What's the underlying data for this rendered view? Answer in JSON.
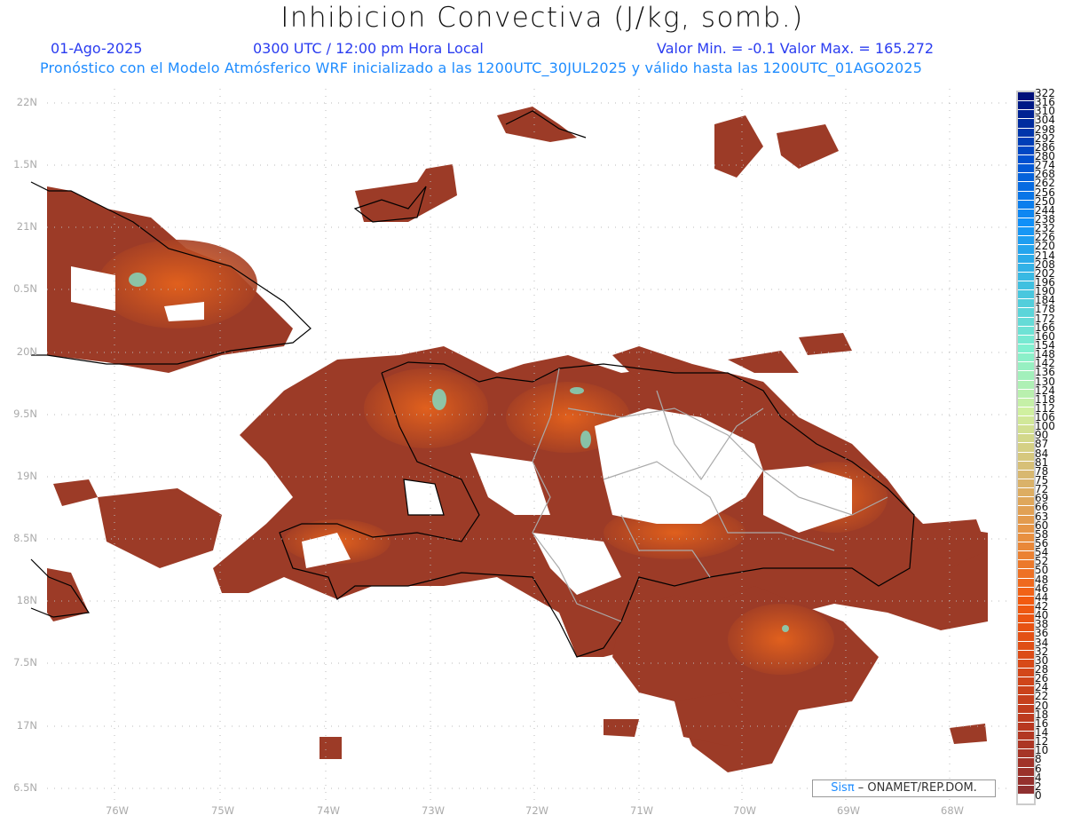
{
  "title": "Inhibicion Convectiva (J/kg, somb.)",
  "date": "01-Ago-2025",
  "time": "0300 UTC / 12:00 pm Hora Local",
  "minmax": "Valor Min. = -0.1  Valor Max. = 165.272",
  "subtitle": "Pronóstico con el Modelo Atmósferico WRF inicializado a las 1200UTC_30JUL2025 y válido hasta las  1200UTC_01AGO2025",
  "lat_labels": [
    "22N",
    "1.5N",
    "21N",
    "0.5N",
    "20N",
    "9.5N",
    "19N",
    "8.5N",
    "18N",
    "7.5N",
    "17N",
    "6.5N"
  ],
  "lon_labels": [
    "76W",
    "75W",
    "74W",
    "73W",
    "72W",
    "71W",
    "70W",
    "69W",
    "68W"
  ],
  "colorbar": {
    "labels": [
      "322",
      "316",
      "310",
      "304",
      "298",
      "292",
      "286",
      "280",
      "274",
      "268",
      "262",
      "256",
      "250",
      "244",
      "238",
      "232",
      "226",
      "220",
      "214",
      "208",
      "202",
      "196",
      "190",
      "184",
      "178",
      "172",
      "166",
      "160",
      "154",
      "148",
      "142",
      "136",
      "130",
      "124",
      "118",
      "112",
      "106",
      "100",
      "90",
      "87",
      "84",
      "81",
      "78",
      "75",
      "72",
      "69",
      "66",
      "63",
      "60",
      "58",
      "56",
      "54",
      "52",
      "50",
      "48",
      "46",
      "44",
      "42",
      "40",
      "38",
      "36",
      "34",
      "32",
      "30",
      "28",
      "26",
      "24",
      "22",
      "20",
      "18",
      "16",
      "14",
      "12",
      "10",
      "8",
      "6",
      "4",
      "2",
      "0"
    ],
    "stops": [
      "#00107a",
      "#0050d0",
      "#1090f8",
      "#40c0e0",
      "#80f0d0",
      "#d0f0a0",
      "#d8b870",
      "#e89040",
      "#f25a10",
      "#d84a18",
      "#b83820",
      "#8f3030"
    ]
  },
  "logo": {
    "brand": "Sisπ",
    "text": " – ONAMET/REP.DOM."
  }
}
